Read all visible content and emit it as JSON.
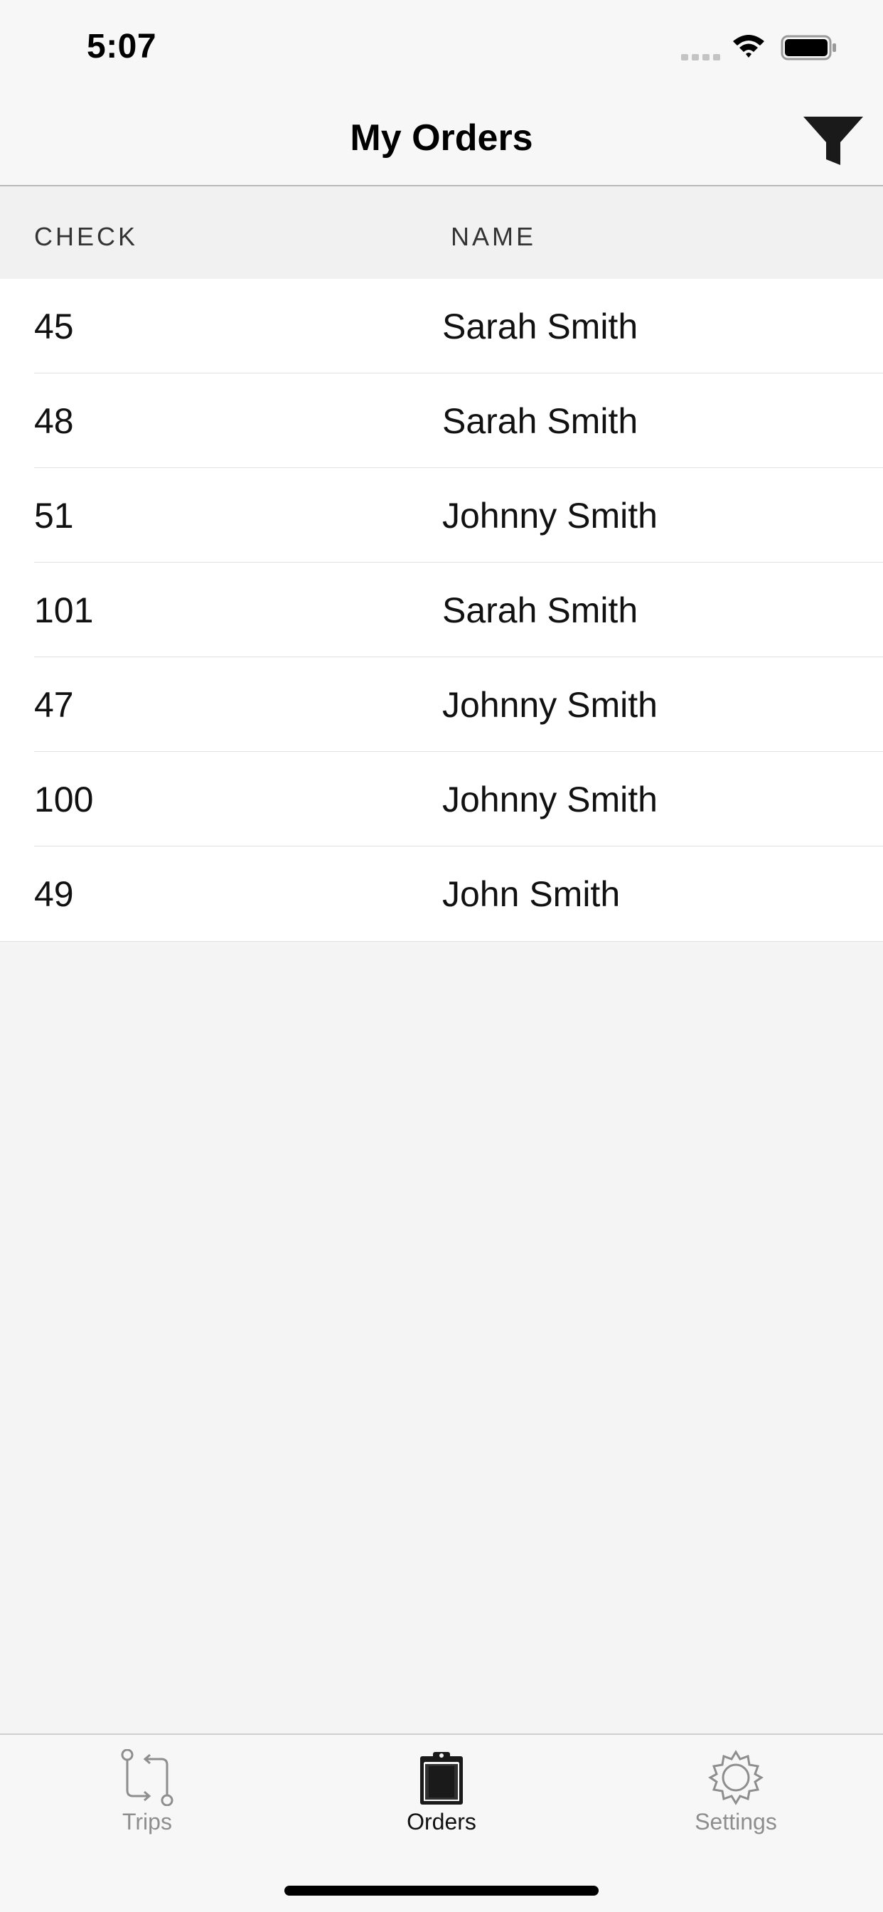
{
  "status_bar": {
    "time": "5:07"
  },
  "nav": {
    "title": "My Orders",
    "filter_icon": "filter-icon"
  },
  "table": {
    "columns": [
      "CHECK",
      "NAME"
    ],
    "rows": [
      {
        "check": "45",
        "name": "Sarah Smith"
      },
      {
        "check": "48",
        "name": "Sarah Smith"
      },
      {
        "check": "51",
        "name": "Johnny Smith"
      },
      {
        "check": "101",
        "name": "Sarah Smith"
      },
      {
        "check": "47",
        "name": "Johnny Smith"
      },
      {
        "check": "100",
        "name": "Johnny Smith"
      },
      {
        "check": "49",
        "name": "John Smith"
      }
    ]
  },
  "tabs": [
    {
      "label": "Trips",
      "icon": "trips-icon",
      "selected": false
    },
    {
      "label": "Orders",
      "icon": "clipboard-icon",
      "selected": true
    },
    {
      "label": "Settings",
      "icon": "gear-icon",
      "selected": false
    }
  ],
  "colors": {
    "bar_background": "#f7f7f7",
    "content_background": "#f4f4f4",
    "selected_tab": "#111111",
    "unselected_tab": "#8e8e8e"
  }
}
